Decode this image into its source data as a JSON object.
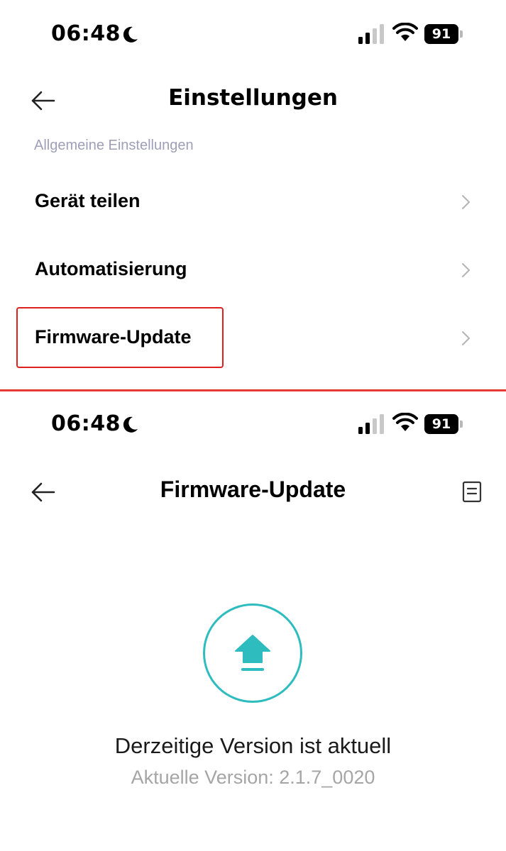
{
  "colors": {
    "accent": "#2fbcbf",
    "highlight": "#e02020",
    "section_label": "#9e9eb8",
    "secondary_text": "#a5a5a5"
  },
  "status_bar": {
    "time": "06:48",
    "battery": "91",
    "icons": [
      "moon-icon",
      "signal-icon",
      "wifi-icon",
      "battery-icon"
    ]
  },
  "settings_screen": {
    "title": "Einstellungen",
    "section_label": "Allgemeine Einstellungen",
    "items": [
      {
        "label": "Gerät teilen"
      },
      {
        "label": "Automatisierung"
      },
      {
        "label": "Firmware-Update",
        "highlighted": true
      }
    ]
  },
  "firmware_screen": {
    "title": "Firmware-Update",
    "status": "Derzeitige Version ist aktuell",
    "version": "Aktuelle Version: 2.1.7_0020"
  }
}
